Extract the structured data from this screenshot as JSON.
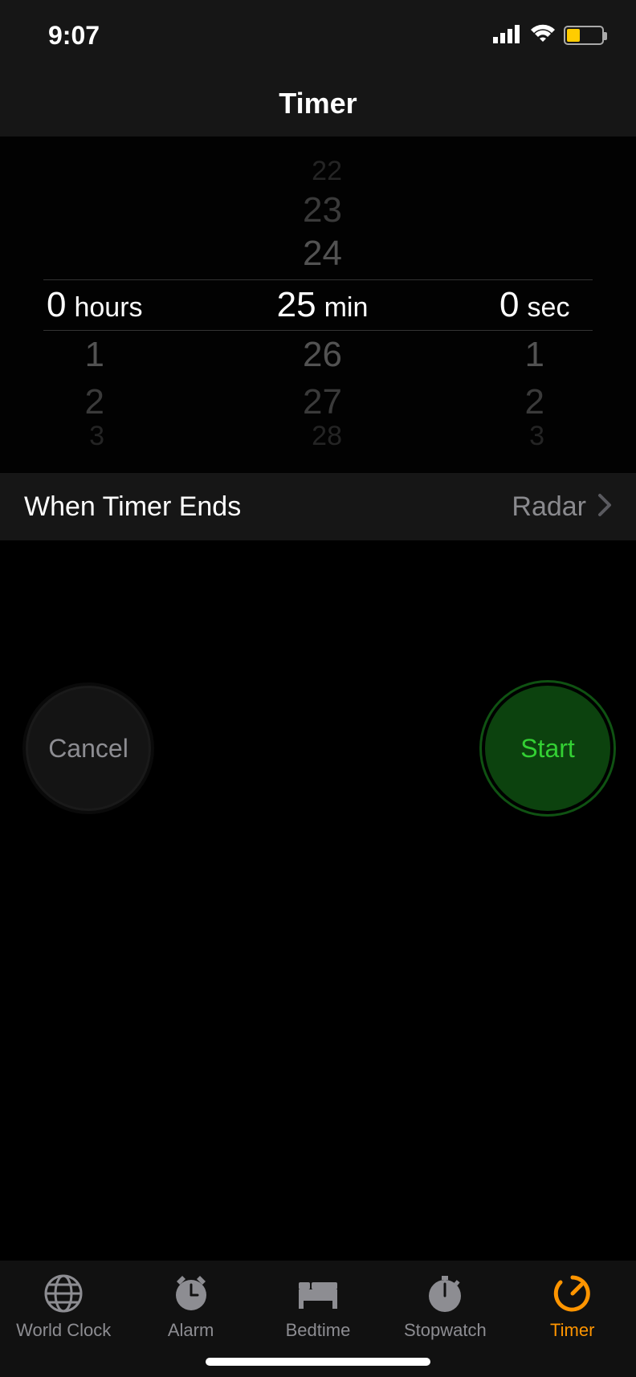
{
  "status": {
    "time": "9:07",
    "battery_percent": 35,
    "battery_color": "#ffcc00"
  },
  "header": {
    "title": "Timer"
  },
  "picker": {
    "hours": {
      "selected": 0,
      "unit": "hours",
      "above": [],
      "below": [
        1,
        2,
        3
      ]
    },
    "minutes": {
      "selected": 25,
      "unit": "min",
      "above": [
        24,
        23,
        22
      ],
      "below": [
        26,
        27,
        28
      ]
    },
    "seconds": {
      "selected": 0,
      "unit": "sec",
      "above": [],
      "below": [
        1,
        2,
        3
      ]
    }
  },
  "settings": {
    "when_ends_label": "When Timer Ends",
    "when_ends_value": "Radar"
  },
  "buttons": {
    "cancel_label": "Cancel",
    "start_label": "Start"
  },
  "tabs": {
    "world_clock": "World Clock",
    "alarm": "Alarm",
    "bedtime": "Bedtime",
    "stopwatch": "Stopwatch",
    "timer": "Timer"
  },
  "colors": {
    "accent": "#ff9500",
    "start_green": "#33d033"
  }
}
